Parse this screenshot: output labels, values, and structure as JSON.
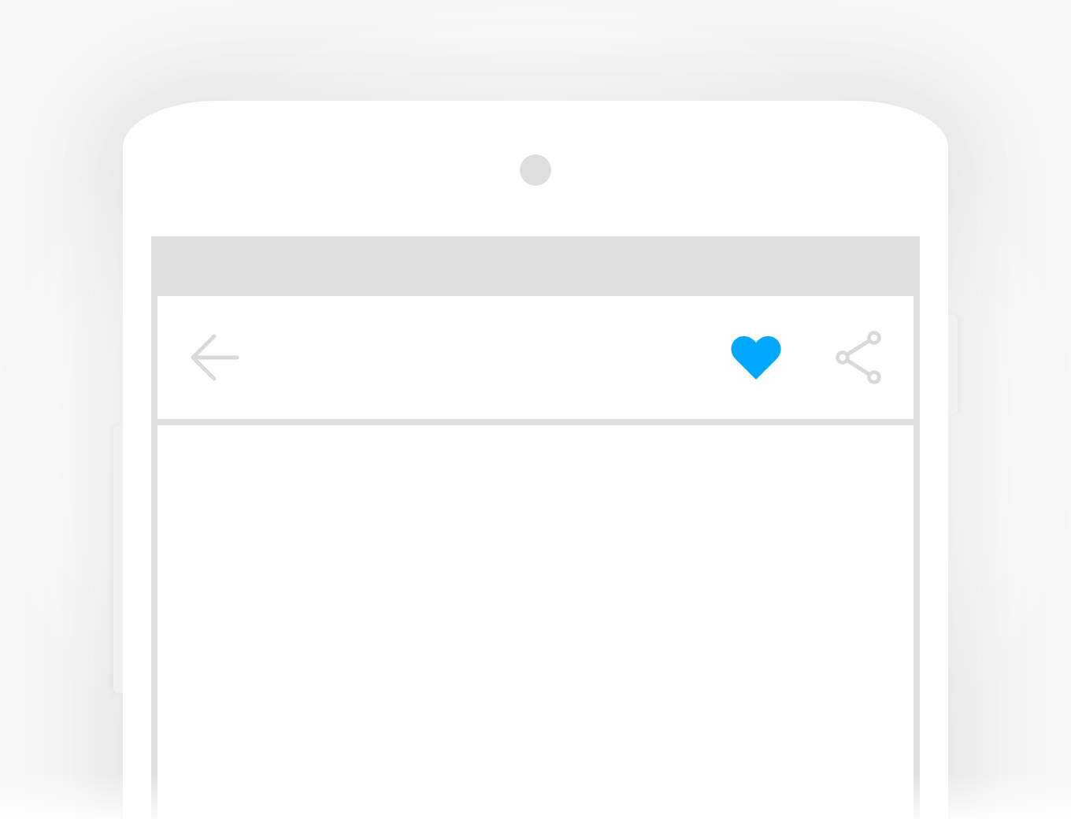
{
  "device": {
    "type": "android-phone-mockup",
    "frame_color": "#ffffff",
    "camera_color": "#dedede"
  },
  "status_bar": {
    "color": "#e0e0e0"
  },
  "app_bar": {
    "back_icon": "arrow-back-icon",
    "favorite_icon": "heart-icon",
    "favorite_active": true,
    "share_icon": "share-icon"
  },
  "colors": {
    "accent": "#00a8ff",
    "icon_inactive": "#d9d9d9",
    "divider": "#e0e0e0"
  }
}
